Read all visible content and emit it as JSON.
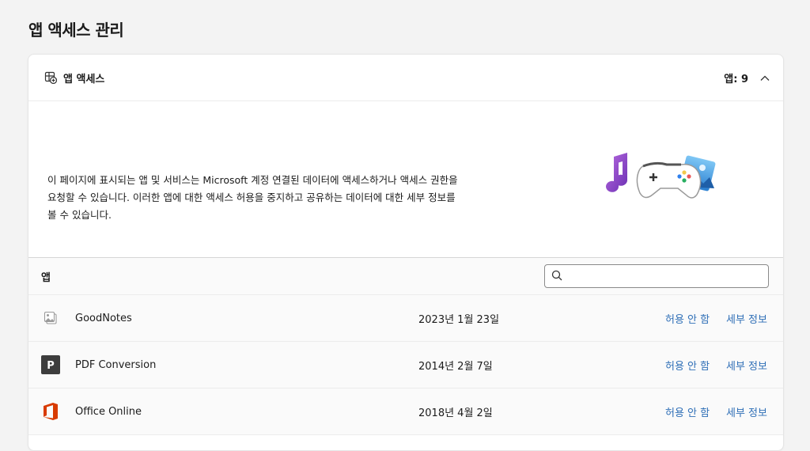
{
  "page": {
    "title": "앱 액세스 관리"
  },
  "card": {
    "header": {
      "title": "앱 액세스",
      "count": "앱: 9",
      "icon": "app-access-icon",
      "collapse_icon": "chevron-up-icon"
    },
    "intro_text": "이 페이지에 표시되는 앱 및 서비스는 Microsoft 계정 연결된 데이터에 액세스하거나 액세스 권한을 요청할 수 있습니다. 이러한 앱에 대한 액세스 허용을 중지하고 공유하는 데이터에 대한 세부 정보를 볼 수 있습니다.",
    "hero_icons": [
      "music-note-icon",
      "game-controller-icon",
      "photo-icon"
    ]
  },
  "apps": {
    "label": "앱",
    "search": {
      "value": "",
      "placeholder": ""
    },
    "rows": [
      {
        "name": "GoodNotes",
        "date": "2023년 1월 23일",
        "disallow": "허용 안 함",
        "details": "세부 정보",
        "icon": "generic-app-icon"
      },
      {
        "name": "PDF Conversion",
        "date": "2014년 2월 7일",
        "disallow": "허용 안 함",
        "details": "세부 정보",
        "icon": "p-letter-icon"
      },
      {
        "name": "Office Online",
        "date": "2018년 4월 2일",
        "disallow": "허용 안 함",
        "details": "세부 정보",
        "icon": "office-logo-icon"
      }
    ]
  },
  "colors": {
    "link": "#2f6fb7",
    "office": "#d83b01",
    "pdf_tile": "#3d3d3d"
  }
}
